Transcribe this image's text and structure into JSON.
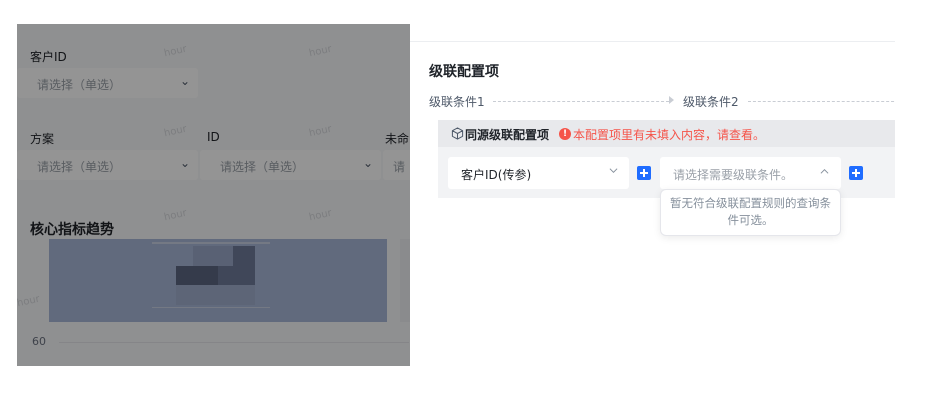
{
  "background": {
    "customer_id_label": "客户ID",
    "customer_id_placeholder": "请选择（单选）",
    "plan_label": "方案",
    "plan_placeholder": "请选择（单选）",
    "id_label": "ID",
    "id_placeholder": "请选择（单选）",
    "partial_label": "未命",
    "partial_placeholder": "请",
    "chart_title": "核心指标趋势",
    "axis_tick": "60",
    "watermark": "hour"
  },
  "drawer": {
    "section_title": "级联配置项",
    "steps": [
      "级联条件1",
      "级联条件2"
    ],
    "group": {
      "title": "同源级联配置项",
      "warning": "本配置项里有未填入内容，请查看。",
      "first_select_value": "客户ID(传参)",
      "second_select_placeholder": "请选择需要级联条件。"
    },
    "tooltip_text": "暂无符合级联配置规则的查询条件可选。"
  },
  "colors": {
    "accent": "#1f6cff",
    "warning": "#f5544a",
    "overlay": "rgba(0,0,0,0.42)"
  }
}
